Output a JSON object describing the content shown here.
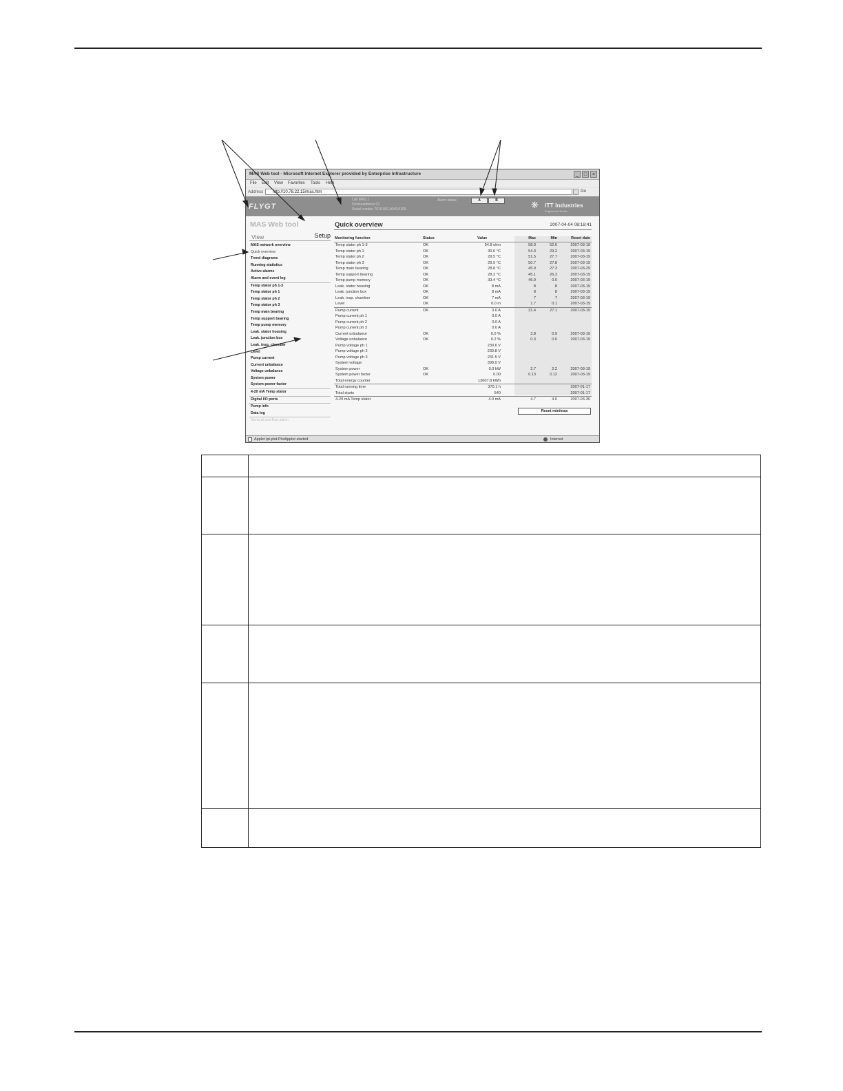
{
  "browser": {
    "title": "MAS Web tool - Microsoft Internet Explorer provided by Enterprise Infrastructure",
    "menu": [
      "File",
      "Edit",
      "View",
      "Favorites",
      "Tools",
      "Help"
    ],
    "address_label": "Address",
    "address_value": "http://10.78.22.15/mas.htm",
    "go_label": "Go",
    "status_left": "Applet ipt.plot.PlotApplet started",
    "status_right": "Internet"
  },
  "banner": {
    "logo": "FLYGT",
    "info_line1": "Lab MAS 1",
    "info_line2": "Deviceaddress 02",
    "info_line3": "Serial number 7010.001.0049.0109",
    "alarm_status_label": "Alarm status",
    "alarm_a": "A",
    "alarm_b": "B",
    "brand": "ITT Industries",
    "brand_tagline": "Engineered for life"
  },
  "sidebar": {
    "app_title": "MAS Web tool",
    "tab_view": "View",
    "tab_setup": "Setup",
    "items": [
      "MAS network overview",
      "Quick overview",
      "Trend diagrams",
      "Running statistics",
      "Active alarms",
      "Alarm and event log",
      "Temp stator ph 1-3",
      "Temp stator ph 1",
      "Temp stator ph 2",
      "Temp stator ph 3",
      "Temp main bearing",
      "Temp support bearing",
      "Temp pump memory",
      "Leak. stator housing",
      "Leak. junction box",
      "Leak. insp. chamber",
      "Level",
      "Pump current",
      "Current unbalance",
      "Voltage unbalance",
      "System power",
      "System power factor",
      "4-20 mA Temp stator",
      "Digital I/O ports",
      "Pump info",
      "Data log",
      "General overflow alarm"
    ]
  },
  "main": {
    "title": "Quick overview",
    "datetime": "2007-04-04 08:18:41",
    "headers": {
      "function": "Monitoring function",
      "status": "Status",
      "value": "Value",
      "max": "Max",
      "min": "Min",
      "reset": "Reset date"
    },
    "rows": [
      {
        "fn": "Temp stator ph 1-3",
        "st": "OK",
        "val": "54.8 ohm",
        "max": "58.0",
        "min": "52.6",
        "rd": "2007-03-19"
      },
      {
        "fn": "Temp stator ph 1",
        "st": "OK",
        "val": "30.6 °C",
        "max": "54.3",
        "min": "29.2",
        "rd": "2007-03-19"
      },
      {
        "fn": "Temp stator ph 2",
        "st": "OK",
        "val": "29.5 °C",
        "max": "51.5",
        "min": "27.7",
        "rd": "2007-03-19"
      },
      {
        "fn": "Temp stator ph 3",
        "st": "OK",
        "val": "29.9 °C",
        "max": "50.7",
        "min": "27.8",
        "rd": "2007-03-19"
      },
      {
        "fn": "Temp main bearing",
        "st": "OK",
        "val": "28.8 °C",
        "max": "45.9",
        "min": "27.3",
        "rd": "2007-03-29"
      },
      {
        "fn": "Temp support bearing",
        "st": "OK",
        "val": "28.2 °C",
        "max": "45.1",
        "min": "26.3",
        "rd": "2007-03-19"
      },
      {
        "fn": "Temp pump memory",
        "st": "OK",
        "val": "33.4 °C",
        "max": "46.0",
        "min": "0.0",
        "rd": "2007-03-19"
      },
      {
        "fn": "Leak. stator housing",
        "st": "OK",
        "val": "8 mA",
        "max": "8",
        "min": "8",
        "rd": "2007-03-19"
      },
      {
        "fn": "Leak. junction box",
        "st": "OK",
        "val": "8 mA",
        "max": "8",
        "min": "8",
        "rd": "2007-03-19"
      },
      {
        "fn": "Leak. insp. chamber",
        "st": "OK",
        "val": "7 mA",
        "max": "7",
        "min": "7",
        "rd": "2007-03-19"
      },
      {
        "fn": "Level",
        "st": "OK",
        "val": "0.0 m",
        "max": "1.7",
        "min": "0.1",
        "rd": "2007-03-19"
      },
      {
        "fn": "Pump current",
        "st": "OK",
        "val": "0.0 A",
        "max": "31.4",
        "min": "27.1",
        "rd": "2007-03-19"
      },
      {
        "fn": "Pump current ph 1",
        "st": "",
        "val": "0.0 A",
        "max": "",
        "min": "",
        "rd": ""
      },
      {
        "fn": "Pump current ph 2",
        "st": "",
        "val": "0.0 A",
        "max": "",
        "min": "",
        "rd": ""
      },
      {
        "fn": "Pump current ph 3",
        "st": "",
        "val": "0.0 A",
        "max": "",
        "min": "",
        "rd": ""
      },
      {
        "fn": "Current unbalance",
        "st": "OK",
        "val": "0.0 %",
        "max": "3.8",
        "min": "0.9",
        "rd": "2007-03-19"
      },
      {
        "fn": "Voltage unbalance",
        "st": "OK",
        "val": "0.2 %",
        "max": "0.3",
        "min": "0.0",
        "rd": "2007-03-19"
      },
      {
        "fn": "Pump voltage ph 1",
        "st": "",
        "val": "230.6 V",
        "max": "",
        "min": "",
        "rd": ""
      },
      {
        "fn": "Pump voltage ph 2",
        "st": "",
        "val": "230.8 V",
        "max": "",
        "min": "",
        "rd": ""
      },
      {
        "fn": "Pump voltage ph 3",
        "st": "",
        "val": "231.5 V",
        "max": "",
        "min": "",
        "rd": ""
      },
      {
        "fn": "System voltage",
        "st": "",
        "val": "399.0 V",
        "max": "",
        "min": "",
        "rd": ""
      },
      {
        "fn": "System power",
        "st": "OK",
        "val": "0.0 kW",
        "max": "2.7",
        "min": "2.2",
        "rd": "2007-03-19"
      },
      {
        "fn": "System power factor",
        "st": "OK",
        "val": "0.00",
        "max": "0.13",
        "min": "0.12",
        "rd": "2007-03-19"
      },
      {
        "fn": "Total energy counter",
        "st": "",
        "val": "13607.8 kWh",
        "max": "",
        "min": "",
        "rd": ""
      },
      {
        "fn": "Total running time",
        "st": "",
        "val": "370.1 h",
        "max": "",
        "min": "",
        "rd": "2007-01-17"
      },
      {
        "fn": "Total starts",
        "st": "",
        "val": "540",
        "max": "",
        "min": "",
        "rd": "2007-01-17"
      },
      {
        "fn": "4-20 mA Temp stator",
        "st": "",
        "val": "4.0 mA",
        "max": "4.7",
        "min": "4.0",
        "rd": "2007-03-30"
      }
    ],
    "reset_button": "Reset min/max"
  }
}
